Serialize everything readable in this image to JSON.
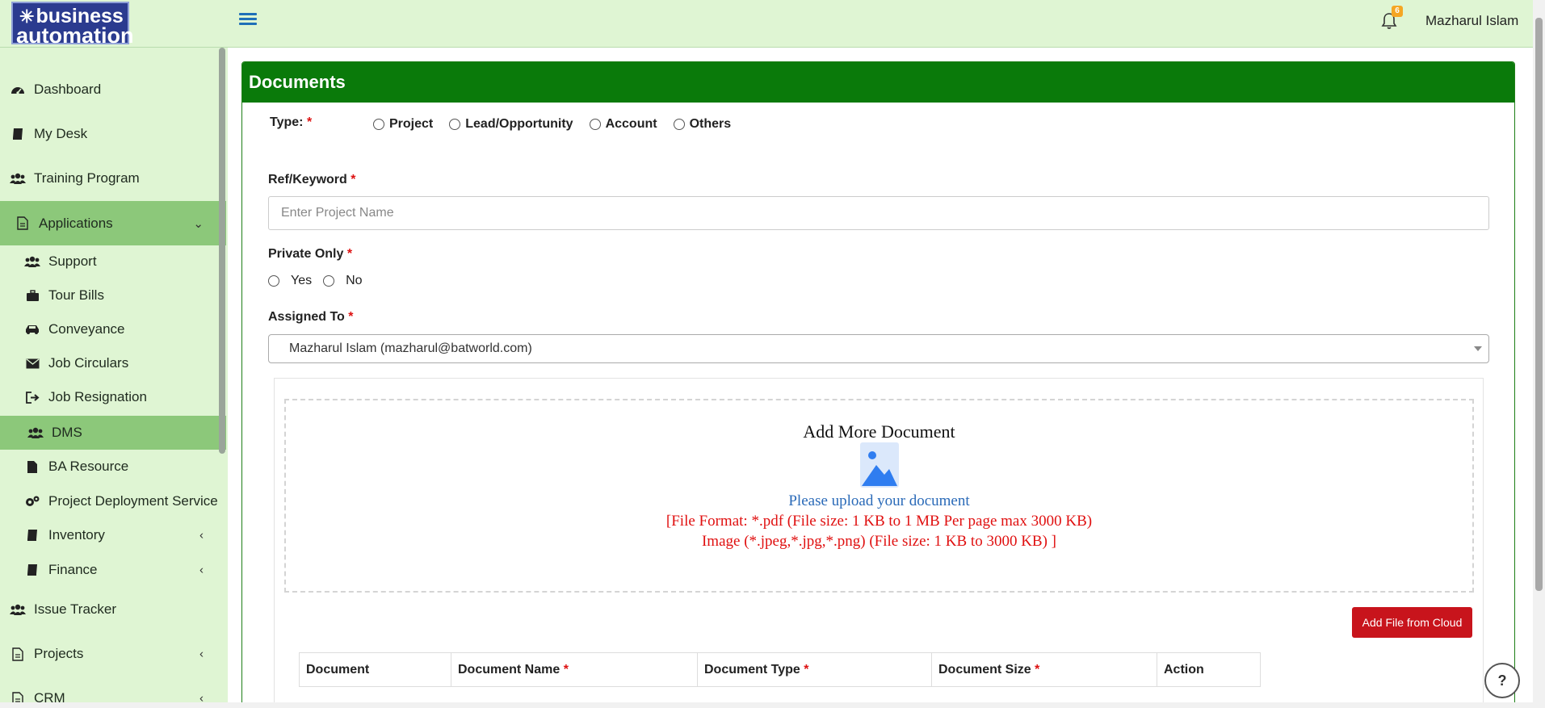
{
  "header": {
    "logo_line1": "business",
    "logo_line2": "automation",
    "notification_count": "6",
    "user_name": "Mazharul Islam"
  },
  "sidebar": {
    "items": [
      {
        "label": "Dashboard",
        "icon": "dashboard-icon"
      },
      {
        "label": "My Desk",
        "icon": "book-icon"
      },
      {
        "label": "Training Program",
        "icon": "users-icon"
      },
      {
        "label": "Applications",
        "icon": "file-icon",
        "expanded": true
      },
      {
        "label": "Support",
        "icon": "users-icon"
      },
      {
        "label": "Tour Bills",
        "icon": "briefcase-icon"
      },
      {
        "label": "Conveyance",
        "icon": "car-icon"
      },
      {
        "label": "Job Circulars",
        "icon": "envelope-icon"
      },
      {
        "label": "Job Resignation",
        "icon": "sign-out-icon"
      },
      {
        "label": "DMS",
        "icon": "users-icon",
        "active": true
      },
      {
        "label": "BA Resource",
        "icon": "file-icon"
      },
      {
        "label": "Project Deployment Service",
        "icon": "gears-icon"
      },
      {
        "label": "Inventory",
        "icon": "book-icon"
      },
      {
        "label": "Finance",
        "icon": "book-icon"
      },
      {
        "label": "Issue Tracker",
        "icon": "users-icon"
      },
      {
        "label": "Projects",
        "icon": "file-icon"
      },
      {
        "label": "CRM",
        "icon": "file-icon"
      }
    ]
  },
  "form": {
    "title": "Documents",
    "type_label": "Type:",
    "type_options": [
      "Project",
      "Lead/Opportunity",
      "Account",
      "Others"
    ],
    "ref_label": "Ref/Keyword",
    "ref_placeholder": "Enter Project Name",
    "private_label": "Private Only",
    "private_options": [
      "Yes",
      "No"
    ],
    "assigned_label": "Assigned To",
    "assigned_value": "Mazharul Islam (mazharul@batworld.com)",
    "required_mark": "*"
  },
  "upload": {
    "title": "Add More Document",
    "prompt": "Please upload your document",
    "rule1": "[File Format: *.pdf (File size: 1 KB to 1 MB Per page max 3000 KB)",
    "rule2": "Image (*.jpeg,*.jpg,*.png) (File size: 1 KB to 3000 KB) ]",
    "cloud_button": "Add File from Cloud"
  },
  "table": {
    "columns": [
      {
        "label": "Document",
        "required": false
      },
      {
        "label": "Document Name",
        "required": true
      },
      {
        "label": "Document Type",
        "required": true
      },
      {
        "label": "Document Size",
        "required": true
      },
      {
        "label": "Action",
        "required": false
      }
    ]
  },
  "help": "?"
}
